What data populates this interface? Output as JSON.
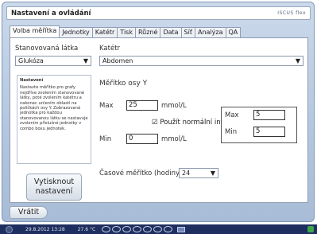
{
  "window": {
    "title": "Nastavení a ovládání",
    "logo_text": "ISCUS flex"
  },
  "tabs": [
    {
      "label": "Volba měřítka",
      "active": true
    },
    {
      "label": "Jednotky",
      "active": false
    },
    {
      "label": "Katétr",
      "active": false
    },
    {
      "label": "Tisk",
      "active": false
    },
    {
      "label": "Různé",
      "active": false
    },
    {
      "label": "Data",
      "active": false
    },
    {
      "label": "Síť",
      "active": false
    },
    {
      "label": "Analýza",
      "active": false
    },
    {
      "label": "QA",
      "active": false
    }
  ],
  "analyte": {
    "label": "Stanovovaná látka",
    "value": "Glukóza"
  },
  "catheter": {
    "label": "Katétr",
    "value": "Abdomen"
  },
  "info": {
    "heading": "Nastavení",
    "text": "Nastavte měřítko pro grafy nejdříve zvolením stanovované látky, poté zvolením katétru a nakonec určením oblasti na políčkách osy Y. Zobrazovaná jednotka pro každou stanovovanou látku se nastavuje zvolením příslušné jednotky v combo boxu jednotek."
  },
  "y_axis": {
    "heading": "Měřítko osy Y",
    "max_label": "Max",
    "max_value": "25",
    "min_label": "Min",
    "min_value": "0",
    "unit": "mmol/L",
    "use_normal_label": "Použít normální interval",
    "use_normal_checked": true
  },
  "normal_interval": {
    "max_label": "Max",
    "max_value": "5",
    "min_label": "Min",
    "min_value": "5"
  },
  "time_scale": {
    "label": "Časové měřítko (hodiny)",
    "value": "24"
  },
  "buttons": {
    "print_line1": "Vytisknout",
    "print_line2": "nastavení",
    "back": "Vrátit"
  },
  "status_bar": {
    "datetime": "29.8.2012 13:28",
    "temperature": "27.6 °C"
  },
  "colors": {
    "frame": "#b3c6de",
    "status_bar": "#1e2f5f"
  }
}
